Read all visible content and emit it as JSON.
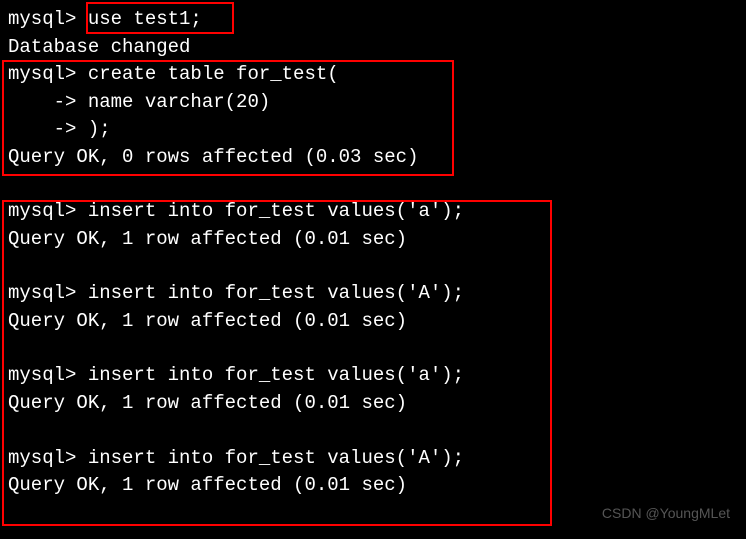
{
  "terminal": {
    "prompt": "mysql>",
    "continuation": "    ->",
    "lines": [
      "mysql> use test1;",
      "Database changed",
      "mysql> create table for_test(",
      "    -> name varchar(20)",
      "    -> );",
      "Query OK, 0 rows affected (0.03 sec)",
      "",
      "mysql> insert into for_test values('a');",
      "Query OK, 1 row affected (0.01 sec)",
      "",
      "mysql> insert into for_test values('A');",
      "Query OK, 1 row affected (0.01 sec)",
      "",
      "mysql> insert into for_test values('a');",
      "Query OK, 1 row affected (0.01 sec)",
      "",
      "mysql> insert into for_test values('A');",
      "Query OK, 1 row affected (0.01 sec)"
    ]
  },
  "watermark": "CSDN @YoungMLet"
}
